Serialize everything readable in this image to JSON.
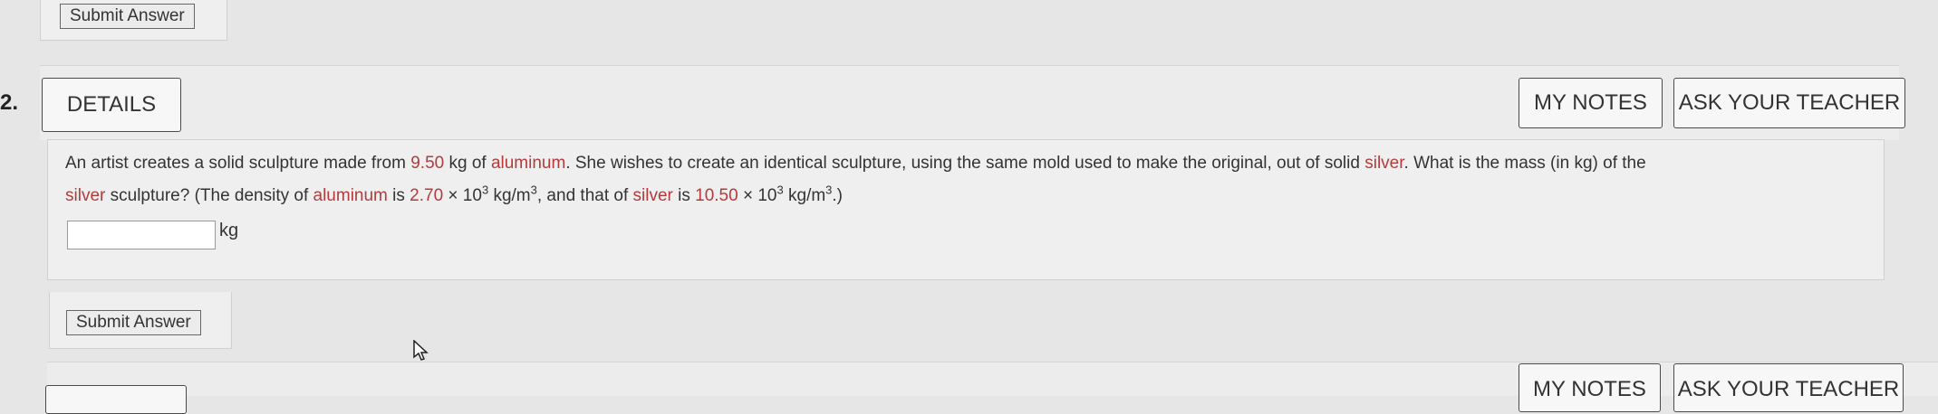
{
  "top": {
    "submit_label": "Submit Answer"
  },
  "question": {
    "number": "2.",
    "details_label": "DETAILS",
    "my_notes_label": "MY NOTES",
    "ask_teacher_label": "ASK YOUR TEACHER",
    "text": {
      "p1": "An artist creates a solid sculpture made from ",
      "mass": "9.50",
      "p2": " kg of ",
      "material1": "aluminum",
      "p3": ". She wishes to create an identical sculpture, using the same mold used to make the original, out of solid ",
      "material2": "silver",
      "p4": ". What is the mass (in kg) of the",
      "p5_silver": "silver",
      "p5": " sculpture? (The density of ",
      "p5_aluminum": "aluminum",
      "p6": " is ",
      "density1": "2.70",
      "times": " × 10",
      "exp1": "3",
      "unit1": " kg/m",
      "unit_exp": "3",
      "p7": ", and that of ",
      "p7_silver": "silver",
      "p8": " is ",
      "density2": "10.50",
      "times2": " × 10",
      "exp2": "3",
      "unit2": " kg/m",
      "unit_exp2": "3",
      "p9": ".)"
    },
    "answer": {
      "value": "",
      "unit": "kg"
    },
    "submit_label": "Submit Answer"
  },
  "next_question": {
    "my_notes_label": "MY NOTES",
    "ask_teacher_label": "ASK YOUR TEACHER"
  },
  "colors": {
    "highlight": "#b33b3b",
    "background": "#e6e6e6"
  }
}
